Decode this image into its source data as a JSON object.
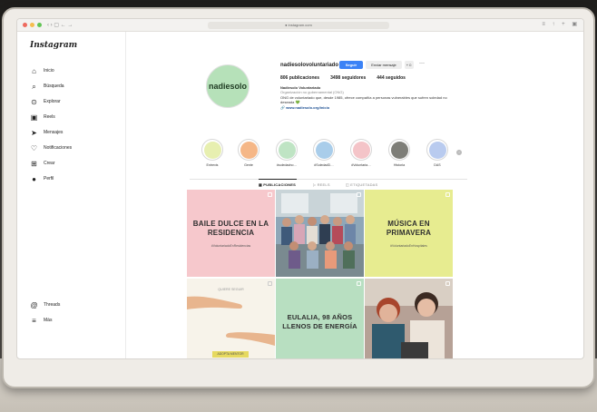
{
  "browser": {
    "url": "● instagram.com",
    "nav_icons": "‹ › ▢ ← →",
    "tools": "≡ ↑ + ▣"
  },
  "sidebar": {
    "logo": "Instagram",
    "items": [
      {
        "label": "Inicio",
        "icon": "home-icon",
        "glyph": "⌂"
      },
      {
        "label": "Búsqueda",
        "icon": "search-icon",
        "glyph": "⌕"
      },
      {
        "label": "Explorar",
        "icon": "compass-icon",
        "glyph": "⊙"
      },
      {
        "label": "Reels",
        "icon": "reels-icon",
        "glyph": "▣"
      },
      {
        "label": "Mensajes",
        "icon": "send-icon",
        "glyph": "➤"
      },
      {
        "label": "Notificaciones",
        "icon": "heart-icon",
        "glyph": "♡"
      },
      {
        "label": "Crear",
        "icon": "plus-square-icon",
        "glyph": "⊞"
      },
      {
        "label": "Perfil",
        "icon": "profile-icon",
        "glyph": "●"
      }
    ],
    "bottom": [
      {
        "label": "Threads",
        "icon": "threads-icon",
        "glyph": "@"
      },
      {
        "label": "Más",
        "icon": "menu-icon",
        "glyph": "≡"
      }
    ]
  },
  "profile": {
    "avatar_text": "nadiesolo",
    "username": "nadiesolovoluntariado",
    "follow_label": "Seguir",
    "message_label": "Enviar mensaje",
    "add_label": "+☺",
    "more_label": "···",
    "stats": {
      "posts": "806 publicaciones",
      "followers": "3498 seguidores",
      "following": "444 seguidos"
    },
    "bio": {
      "name": "Nadiesolo Voluntariado",
      "category": "Organización no gubernamental (ONG)",
      "text": "ONG de voluntariado que, desde 1985, ofrece compañía a personas vulnerables que sufren soledad no deseada 💚",
      "link": "🔗 www.nadiesolo.org/inicio"
    }
  },
  "highlights": [
    {
      "label": "Entrevis",
      "color": "#e7efb0"
    },
    {
      "label": "Gente",
      "color": "#f5b787"
    },
    {
      "label": "#soledadno…",
      "color": "#bfe4c4"
    },
    {
      "label": "#SoledadD…",
      "color": "#a9cdea"
    },
    {
      "label": "#Voluntaria…",
      "color": "#f4c4c8"
    },
    {
      "label": "Historia",
      "color": "#7e7e78"
    },
    {
      "label": "DAS",
      "color": "#b9cbef"
    }
  ],
  "tabs": [
    {
      "label": "▦ PUBLICACIONES"
    },
    {
      "label": "▷ REELS"
    },
    {
      "label": "◫ ETIQUETADAS"
    }
  ],
  "posts": [
    {
      "title": "BAILE DULCE EN LA RESIDENCIA",
      "tag": "#VoluntariadoEnResidencias",
      "bg": "#f6c8cc"
    },
    {
      "title": "",
      "tag": "",
      "bg": "#8fa7b8"
    },
    {
      "title": "MÚSICA EN PRIMAVERA",
      "tag": "#VoluntariadoEnHospitales",
      "bg": "#e7ec90"
    },
    {
      "title": "QUIERE SEGUIR",
      "tag": "ADOPTA MENTOR",
      "bg": "#f7f3ea"
    },
    {
      "title": "EULALIA, 98 AÑOS LLENOS DE ENERGÍA",
      "tag": "",
      "bg": "#b8dfc1"
    },
    {
      "title": "",
      "tag": "",
      "bg": "#a1887f"
    }
  ]
}
